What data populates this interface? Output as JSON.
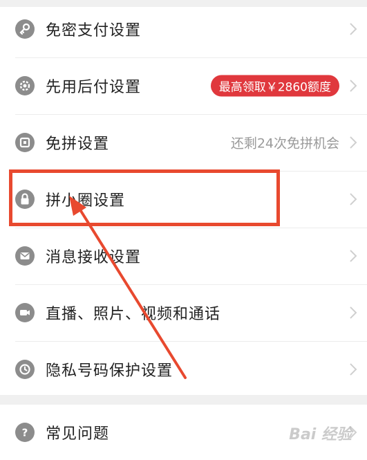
{
  "settings": {
    "items": [
      {
        "label": "免密支付设置",
        "icon": "key-icon"
      },
      {
        "label": "先用后付设置",
        "icon": "gear-icon",
        "badge": "最高领取￥2860额度"
      },
      {
        "label": "免拼设置",
        "icon": "ticket-icon",
        "hint": "还剩24次免拼机会"
      },
      {
        "label": "拼小圈设置",
        "icon": "lock-icon"
      },
      {
        "label": "消息接收设置",
        "icon": "mail-icon"
      },
      {
        "label": "直播、照片、视频和通话",
        "icon": "camera-icon"
      },
      {
        "label": "隐私号码保护设置",
        "icon": "shield-icon"
      }
    ],
    "help": {
      "label": "常见问题",
      "icon": "question-icon"
    }
  },
  "watermark": "Bai 经验",
  "colors": {
    "accent": "#e0383d",
    "highlight": "#e8492f",
    "icon": "#8c8c8c",
    "hint": "#9a9a9a"
  }
}
